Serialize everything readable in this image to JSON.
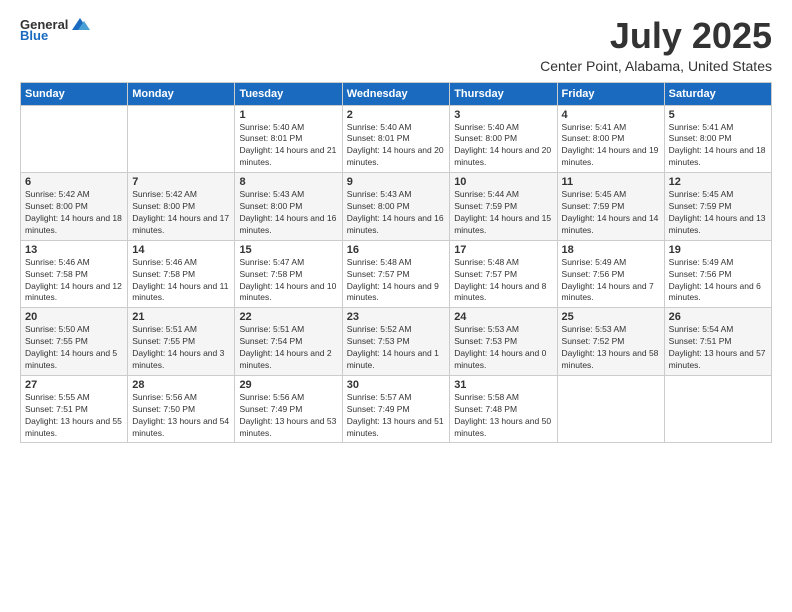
{
  "logo": {
    "general": "General",
    "blue": "Blue"
  },
  "header": {
    "title": "July 2025",
    "subtitle": "Center Point, Alabama, United States"
  },
  "weekdays": [
    "Sunday",
    "Monday",
    "Tuesday",
    "Wednesday",
    "Thursday",
    "Friday",
    "Saturday"
  ],
  "weeks": [
    [
      {
        "day": "",
        "info": ""
      },
      {
        "day": "",
        "info": ""
      },
      {
        "day": "1",
        "info": "Sunrise: 5:40 AM\nSunset: 8:01 PM\nDaylight: 14 hours and 21 minutes."
      },
      {
        "day": "2",
        "info": "Sunrise: 5:40 AM\nSunset: 8:01 PM\nDaylight: 14 hours and 20 minutes."
      },
      {
        "day": "3",
        "info": "Sunrise: 5:40 AM\nSunset: 8:00 PM\nDaylight: 14 hours and 20 minutes."
      },
      {
        "day": "4",
        "info": "Sunrise: 5:41 AM\nSunset: 8:00 PM\nDaylight: 14 hours and 19 minutes."
      },
      {
        "day": "5",
        "info": "Sunrise: 5:41 AM\nSunset: 8:00 PM\nDaylight: 14 hours and 18 minutes."
      }
    ],
    [
      {
        "day": "6",
        "info": "Sunrise: 5:42 AM\nSunset: 8:00 PM\nDaylight: 14 hours and 18 minutes."
      },
      {
        "day": "7",
        "info": "Sunrise: 5:42 AM\nSunset: 8:00 PM\nDaylight: 14 hours and 17 minutes."
      },
      {
        "day": "8",
        "info": "Sunrise: 5:43 AM\nSunset: 8:00 PM\nDaylight: 14 hours and 16 minutes."
      },
      {
        "day": "9",
        "info": "Sunrise: 5:43 AM\nSunset: 8:00 PM\nDaylight: 14 hours and 16 minutes."
      },
      {
        "day": "10",
        "info": "Sunrise: 5:44 AM\nSunset: 7:59 PM\nDaylight: 14 hours and 15 minutes."
      },
      {
        "day": "11",
        "info": "Sunrise: 5:45 AM\nSunset: 7:59 PM\nDaylight: 14 hours and 14 minutes."
      },
      {
        "day": "12",
        "info": "Sunrise: 5:45 AM\nSunset: 7:59 PM\nDaylight: 14 hours and 13 minutes."
      }
    ],
    [
      {
        "day": "13",
        "info": "Sunrise: 5:46 AM\nSunset: 7:58 PM\nDaylight: 14 hours and 12 minutes."
      },
      {
        "day": "14",
        "info": "Sunrise: 5:46 AM\nSunset: 7:58 PM\nDaylight: 14 hours and 11 minutes."
      },
      {
        "day": "15",
        "info": "Sunrise: 5:47 AM\nSunset: 7:58 PM\nDaylight: 14 hours and 10 minutes."
      },
      {
        "day": "16",
        "info": "Sunrise: 5:48 AM\nSunset: 7:57 PM\nDaylight: 14 hours and 9 minutes."
      },
      {
        "day": "17",
        "info": "Sunrise: 5:48 AM\nSunset: 7:57 PM\nDaylight: 14 hours and 8 minutes."
      },
      {
        "day": "18",
        "info": "Sunrise: 5:49 AM\nSunset: 7:56 PM\nDaylight: 14 hours and 7 minutes."
      },
      {
        "day": "19",
        "info": "Sunrise: 5:49 AM\nSunset: 7:56 PM\nDaylight: 14 hours and 6 minutes."
      }
    ],
    [
      {
        "day": "20",
        "info": "Sunrise: 5:50 AM\nSunset: 7:55 PM\nDaylight: 14 hours and 5 minutes."
      },
      {
        "day": "21",
        "info": "Sunrise: 5:51 AM\nSunset: 7:55 PM\nDaylight: 14 hours and 3 minutes."
      },
      {
        "day": "22",
        "info": "Sunrise: 5:51 AM\nSunset: 7:54 PM\nDaylight: 14 hours and 2 minutes."
      },
      {
        "day": "23",
        "info": "Sunrise: 5:52 AM\nSunset: 7:53 PM\nDaylight: 14 hours and 1 minute."
      },
      {
        "day": "24",
        "info": "Sunrise: 5:53 AM\nSunset: 7:53 PM\nDaylight: 14 hours and 0 minutes."
      },
      {
        "day": "25",
        "info": "Sunrise: 5:53 AM\nSunset: 7:52 PM\nDaylight: 13 hours and 58 minutes."
      },
      {
        "day": "26",
        "info": "Sunrise: 5:54 AM\nSunset: 7:51 PM\nDaylight: 13 hours and 57 minutes."
      }
    ],
    [
      {
        "day": "27",
        "info": "Sunrise: 5:55 AM\nSunset: 7:51 PM\nDaylight: 13 hours and 55 minutes."
      },
      {
        "day": "28",
        "info": "Sunrise: 5:56 AM\nSunset: 7:50 PM\nDaylight: 13 hours and 54 minutes."
      },
      {
        "day": "29",
        "info": "Sunrise: 5:56 AM\nSunset: 7:49 PM\nDaylight: 13 hours and 53 minutes."
      },
      {
        "day": "30",
        "info": "Sunrise: 5:57 AM\nSunset: 7:49 PM\nDaylight: 13 hours and 51 minutes."
      },
      {
        "day": "31",
        "info": "Sunrise: 5:58 AM\nSunset: 7:48 PM\nDaylight: 13 hours and 50 minutes."
      },
      {
        "day": "",
        "info": ""
      },
      {
        "day": "",
        "info": ""
      }
    ]
  ]
}
